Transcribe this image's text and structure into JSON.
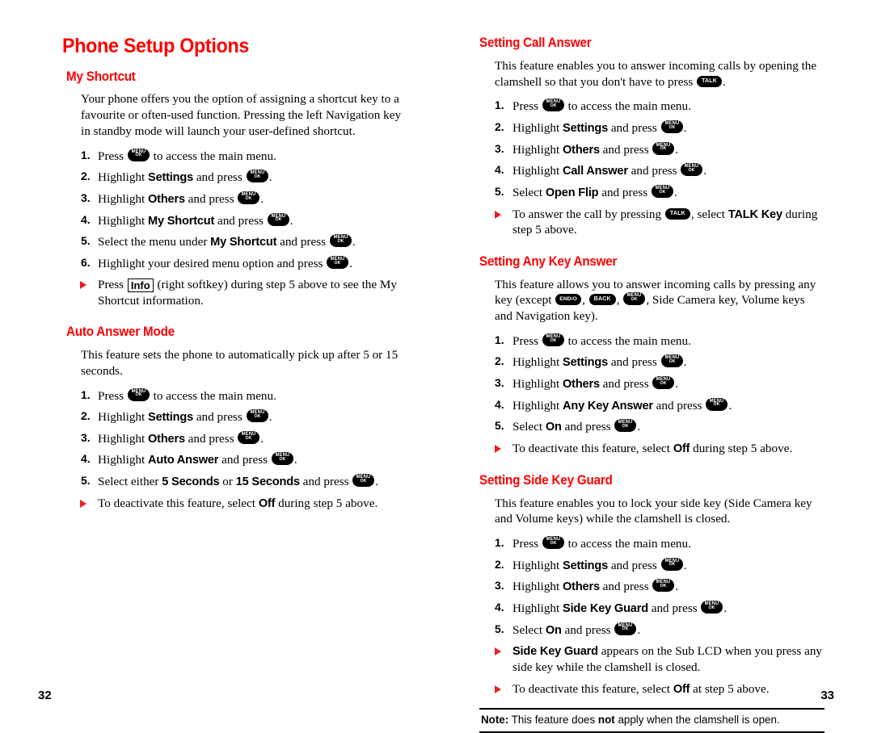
{
  "document": {
    "title": "Phone Setup Options",
    "accent_red": "#ff0000",
    "bullet_red": "#ee1c25",
    "left_page_number": "32",
    "right_page_number": "33"
  },
  "keys": {
    "menu_ok": {
      "line1": "MENU",
      "line2": "OK"
    },
    "talk": {
      "label": "TALK"
    },
    "back": {
      "label": "BACK"
    },
    "end_o": {
      "label": "END/O"
    },
    "info_softkey": {
      "label": "Info"
    }
  },
  "left_column": {
    "page_title": "Phone Setup Options",
    "sections": [
      {
        "heading": "My Shortcut",
        "intro": "Your phone offers you the option of assigning a shortcut key to a favourite or often-used function. Pressing the left Navigation key in standby mode will launch your user-defined shortcut.",
        "steps": [
          {
            "num": "1.",
            "pre": "Press ",
            "key": "menu_ok",
            "post": " to access the main menu."
          },
          {
            "num": "2.",
            "pre": "Highlight ",
            "term": "Settings",
            "mid": " and press ",
            "key": "menu_ok",
            "post": "."
          },
          {
            "num": "3.",
            "pre": "Highlight ",
            "term": "Others",
            "mid": " and press ",
            "key": "menu_ok",
            "post": "."
          },
          {
            "num": "4.",
            "pre": "Highlight ",
            "term": "My Shortcut",
            "mid": " and press ",
            "key": "menu_ok",
            "post": "."
          },
          {
            "num": "5.",
            "pre": "Select the menu under ",
            "term": "My Shortcut",
            "mid": " and press ",
            "key": "menu_ok",
            "post": "."
          },
          {
            "num": "6.",
            "pre": "Highlight your desired menu option and press ",
            "key": "menu_ok",
            "post": "."
          }
        ],
        "bullets": [
          {
            "pre": "Press ",
            "softkey": "Info",
            "post": " (right softkey) during step 5 above to see the My Shortcut information."
          }
        ]
      },
      {
        "heading": "Auto Answer Mode",
        "intro": "This feature sets the phone to automatically pick up after 5 or 15 seconds.",
        "steps": [
          {
            "num": "1.",
            "pre": "Press ",
            "key": "menu_ok",
            "post": " to access the main menu."
          },
          {
            "num": "2.",
            "pre": "Highlight ",
            "term": "Settings",
            "mid": " and press ",
            "key": "menu_ok",
            "post": "."
          },
          {
            "num": "3.",
            "pre": "Highlight ",
            "term": "Others",
            "mid": " and press ",
            "key": "menu_ok",
            "post": "."
          },
          {
            "num": "4.",
            "pre": "Highlight ",
            "term": "Auto Answer",
            "mid": " and press ",
            "key": "menu_ok",
            "post": "."
          },
          {
            "num": "5.",
            "pre": "Select either ",
            "term": "5 Seconds",
            "mid": " or ",
            "term2": "15 Seconds",
            "mid2": " and press ",
            "key": "menu_ok",
            "post": "."
          }
        ],
        "bullets": [
          {
            "pre": "To deactivate this feature, select ",
            "term": "Off",
            "post": " during step 5 above."
          }
        ]
      }
    ]
  },
  "right_column": {
    "sections": [
      {
        "heading": "Setting Call Answer",
        "intro_pre": "This feature enables you to answer incoming calls by opening the clamshell so that you don't have to press ",
        "intro_key": "talk",
        "intro_post": ".",
        "steps": [
          {
            "num": "1.",
            "pre": "Press ",
            "key": "menu_ok",
            "post": " to access the main menu."
          },
          {
            "num": "2.",
            "pre": "Highlight ",
            "term": "Settings",
            "mid": " and press ",
            "key": "menu_ok",
            "post": "."
          },
          {
            "num": "3.",
            "pre": "Highlight ",
            "term": "Others",
            "mid": " and press ",
            "key": "menu_ok",
            "post": "."
          },
          {
            "num": "4.",
            "pre": "Highlight ",
            "term": "Call Answer",
            "mid": " and press ",
            "key": "menu_ok",
            "post": "."
          },
          {
            "num": "5.",
            "pre": "Select ",
            "term": "Open Flip",
            "mid": " and press ",
            "key": "menu_ok",
            "post": "."
          }
        ],
        "bullets": [
          {
            "pre": "To answer the call by pressing ",
            "key": "talk",
            "mid": ", select ",
            "term": "TALK Key",
            "post": " during step 5 above."
          }
        ]
      },
      {
        "heading": "Setting Any Key Answer",
        "intro_a": "This feature allows you to answer incoming calls by pressing any key (except ",
        "intro_keys": [
          "end_o",
          "back",
          "menu_ok"
        ],
        "intro_b": ", Side Camera key, Volume keys and Navigation key).",
        "steps": [
          {
            "num": "1.",
            "pre": "Press ",
            "key": "menu_ok",
            "post": " to access the main menu."
          },
          {
            "num": "2.",
            "pre": "Highlight ",
            "term": "Settings",
            "mid": " and press ",
            "key": "menu_ok",
            "post": "."
          },
          {
            "num": "3.",
            "pre": "Highlight ",
            "term": "Others",
            "mid": " and press ",
            "key": "menu_ok",
            "post": "."
          },
          {
            "num": "4.",
            "pre": "Highlight ",
            "term": "Any Key Answer",
            "mid": " and press ",
            "key": "menu_ok",
            "post": "."
          },
          {
            "num": "5.",
            "pre": "Select ",
            "term": "On",
            "mid": " and press ",
            "key": "menu_ok",
            "post": "."
          }
        ],
        "bullets": [
          {
            "pre": "To deactivate this feature, select ",
            "term": "Off",
            "post": " during step 5 above."
          }
        ]
      },
      {
        "heading": "Setting Side Key Guard",
        "intro": "This feature enables you to lock your side key (Side Camera key and Volume keys) while the clamshell is closed.",
        "steps": [
          {
            "num": "1.",
            "pre": "Press ",
            "key": "menu_ok",
            "post": " to access the main menu."
          },
          {
            "num": "2.",
            "pre": "Highlight ",
            "term": "Settings",
            "mid": " and press ",
            "key": "menu_ok",
            "post": "."
          },
          {
            "num": "3.",
            "pre": "Highlight ",
            "term": "Others",
            "mid": " and press ",
            "key": "menu_ok",
            "post": "."
          },
          {
            "num": "4.",
            "pre": "Highlight ",
            "term": "Side Key Guard",
            "mid": " and press ",
            "key": "menu_ok",
            "post": "."
          },
          {
            "num": "5.",
            "pre": "Select ",
            "term": "On",
            "mid": " and press ",
            "key": "menu_ok",
            "post": "."
          }
        ],
        "bullets": [
          {
            "term_first": "Side Key Guard",
            "post": " appears on the Sub LCD when you press any side key while the clamshell is closed."
          },
          {
            "pre": "To deactivate this feature, select ",
            "term": "Off",
            "post": " at step 5 above."
          }
        ]
      }
    ],
    "note": {
      "label": "Note:",
      "text_a": " This feature does ",
      "emphasis": "not",
      "text_b": " apply when the clamshell is open."
    }
  }
}
